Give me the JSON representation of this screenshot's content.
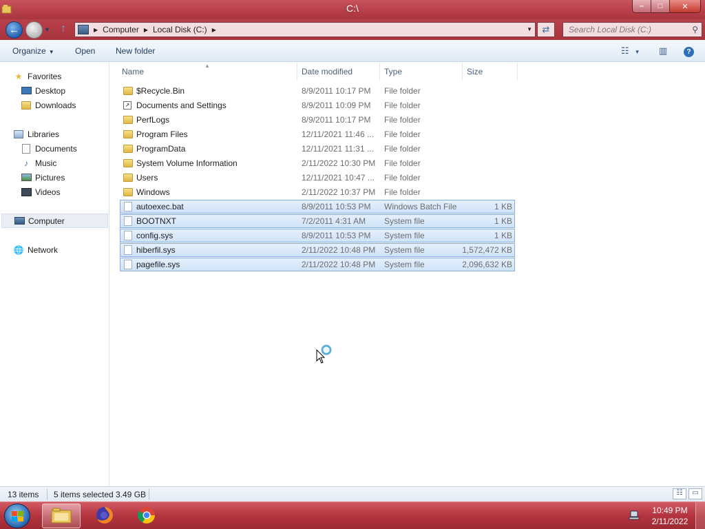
{
  "window": {
    "title": "C:\\",
    "controls": {
      "minimize": "–",
      "maximize": "□",
      "close": "✕"
    }
  },
  "address": {
    "crumbs": [
      "Computer",
      "Local Disk (C:)"
    ],
    "search_placeholder": "Search Local Disk (C:)"
  },
  "commandbar": {
    "organize": "Organize",
    "open": "Open",
    "new_folder": "New folder"
  },
  "navpane": {
    "favorites": "Favorites",
    "desktop": "Desktop",
    "downloads": "Downloads",
    "libraries": "Libraries",
    "documents": "Documents",
    "music": "Music",
    "pictures": "Pictures",
    "videos": "Videos",
    "computer": "Computer",
    "network": "Network"
  },
  "columns": {
    "name": "Name",
    "date": "Date modified",
    "type": "Type",
    "size": "Size"
  },
  "files": [
    {
      "name": "$Recycle.Bin",
      "date": "8/9/2011 10:17 PM",
      "type": "File folder",
      "size": "",
      "icon": "folder-icon",
      "selected": false
    },
    {
      "name": "Documents and Settings",
      "date": "8/9/2011 10:09 PM",
      "type": "File folder",
      "size": "",
      "icon": "shortcut-icon",
      "selected": false
    },
    {
      "name": "PerfLogs",
      "date": "8/9/2011 10:17 PM",
      "type": "File folder",
      "size": "",
      "icon": "folder-icon",
      "selected": false
    },
    {
      "name": "Program Files",
      "date": "12/11/2021 11:46 ...",
      "type": "File folder",
      "size": "",
      "icon": "folder-icon",
      "selected": false
    },
    {
      "name": "ProgramData",
      "date": "12/11/2021 11:31 ...",
      "type": "File folder",
      "size": "",
      "icon": "folder-icon",
      "selected": false
    },
    {
      "name": "System Volume Information",
      "date": "2/11/2022 10:30 PM",
      "type": "File folder",
      "size": "",
      "icon": "folder-icon",
      "selected": false
    },
    {
      "name": "Users",
      "date": "12/11/2021 10:47 ...",
      "type": "File folder",
      "size": "",
      "icon": "folder-icon",
      "selected": false
    },
    {
      "name": "Windows",
      "date": "2/11/2022 10:37 PM",
      "type": "File folder",
      "size": "",
      "icon": "folder-icon",
      "selected": false
    },
    {
      "name": "autoexec.bat",
      "date": "8/9/2011 10:53 PM",
      "type": "Windows Batch File",
      "size": "1 KB",
      "icon": "system-file-icon",
      "selected": true
    },
    {
      "name": "BOOTNXT",
      "date": "7/2/2011 4:31 AM",
      "type": "System file",
      "size": "1 KB",
      "icon": "system-file-icon",
      "selected": true
    },
    {
      "name": "config.sys",
      "date": "8/9/2011 10:53 PM",
      "type": "System file",
      "size": "1 KB",
      "icon": "system-file-icon",
      "selected": true
    },
    {
      "name": "hiberfil.sys",
      "date": "2/11/2022 10:48 PM",
      "type": "System file",
      "size": "1,572,472 KB",
      "icon": "system-file-icon",
      "selected": true
    },
    {
      "name": "pagefile.sys",
      "date": "2/11/2022 10:48 PM",
      "type": "System file",
      "size": "2,096,632 KB",
      "icon": "system-file-icon",
      "selected": true
    }
  ],
  "status": {
    "items": "13 items",
    "selected": "5 items selected",
    "size": "3.49 GB"
  },
  "taskbar": {
    "time": "10:49 PM",
    "date": "2/11/2022"
  },
  "colors": {
    "titlebar": "#b8404a",
    "selection": "#cfe3f8",
    "selection_border": "#84acdd"
  }
}
